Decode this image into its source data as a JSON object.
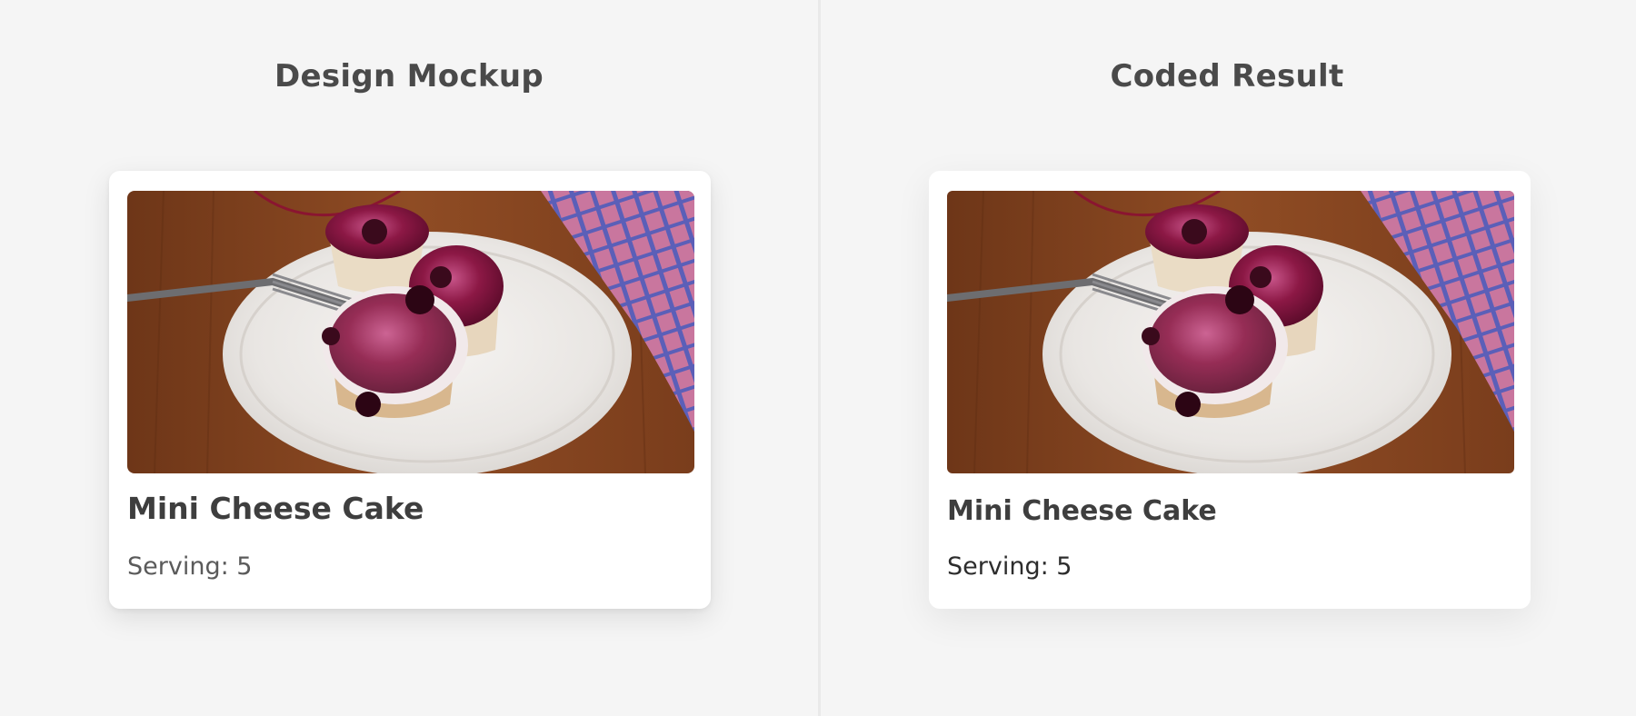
{
  "panels": [
    {
      "heading": "Design Mockup",
      "card": {
        "title": "Mini Cheese Cake",
        "serving": "Serving: 5"
      }
    },
    {
      "heading": "Coded Result",
      "card": {
        "title": "Mini Cheese Cake",
        "serving": "Serving: 5"
      }
    }
  ],
  "colors": {
    "background": "#f5f5f5",
    "card": "#ffffff",
    "heading_text": "#4a4a4a",
    "wood": "#8a4a24",
    "berry": "#8c1845",
    "towel_pink": "#c9769e",
    "towel_blue": "#5b5fb8",
    "plate": "#ececec"
  }
}
